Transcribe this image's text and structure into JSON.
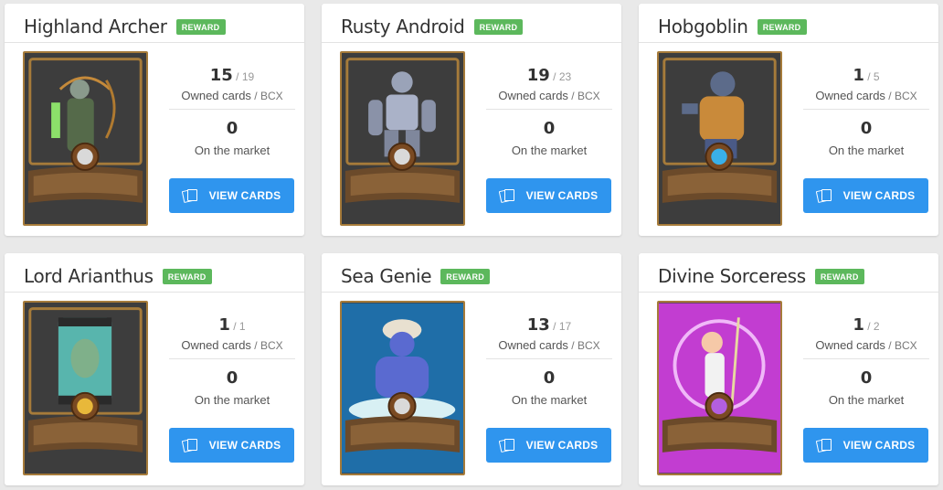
{
  "cards": [
    {
      "name": "Highland Archer",
      "badge": "REWARD",
      "owned": "15",
      "bcx": "19",
      "owned_label": "Owned cards",
      "bcx_label": "BCX",
      "market": "0",
      "market_label": "On the market",
      "button": "VIEW CARDS",
      "art": "archer",
      "gem_color": "#d9d9d9",
      "bg": "#3d3d3d"
    },
    {
      "name": "Rusty Android",
      "badge": "REWARD",
      "owned": "19",
      "bcx": "23",
      "owned_label": "Owned cards",
      "bcx_label": "BCX",
      "market": "0",
      "market_label": "On the market",
      "button": "VIEW CARDS",
      "art": "android",
      "gem_color": "#d9d9d9",
      "bg": "#3d3d3d"
    },
    {
      "name": "Hobgoblin",
      "badge": "REWARD",
      "owned": "1",
      "bcx": "5",
      "owned_label": "Owned cards",
      "bcx_label": "BCX",
      "market": "0",
      "market_label": "On the market",
      "button": "VIEW CARDS",
      "art": "goblin",
      "gem_color": "#3ab0e8",
      "bg": "#3d3d3d"
    },
    {
      "name": "Lord Arianthus",
      "badge": "REWARD",
      "owned": "1",
      "bcx": "1",
      "owned_label": "Owned cards",
      "bcx_label": "BCX",
      "market": "0",
      "market_label": "On the market",
      "button": "VIEW CARDS",
      "art": "lord",
      "gem_color": "#e8b83a",
      "bg": "#3d3d3d"
    },
    {
      "name": "Sea Genie",
      "badge": "REWARD",
      "owned": "13",
      "bcx": "17",
      "owned_label": "Owned cards",
      "bcx_label": "BCX",
      "market": "0",
      "market_label": "On the market",
      "button": "VIEW CARDS",
      "art": "genie",
      "gem_color": "#d9d9d9",
      "bg": "#1f6ea8"
    },
    {
      "name": "Divine Sorceress",
      "badge": "REWARD",
      "owned": "1",
      "bcx": "2",
      "owned_label": "Owned cards",
      "bcx_label": "BCX",
      "market": "0",
      "market_label": "On the market",
      "button": "VIEW CARDS",
      "art": "sorceress",
      "gem_color": "#b35fe0",
      "bg": "#c23dd1"
    }
  ],
  "colors": {
    "accent": "#2f95ee",
    "badge": "#5cb85c",
    "frame": "#a67b3a"
  }
}
